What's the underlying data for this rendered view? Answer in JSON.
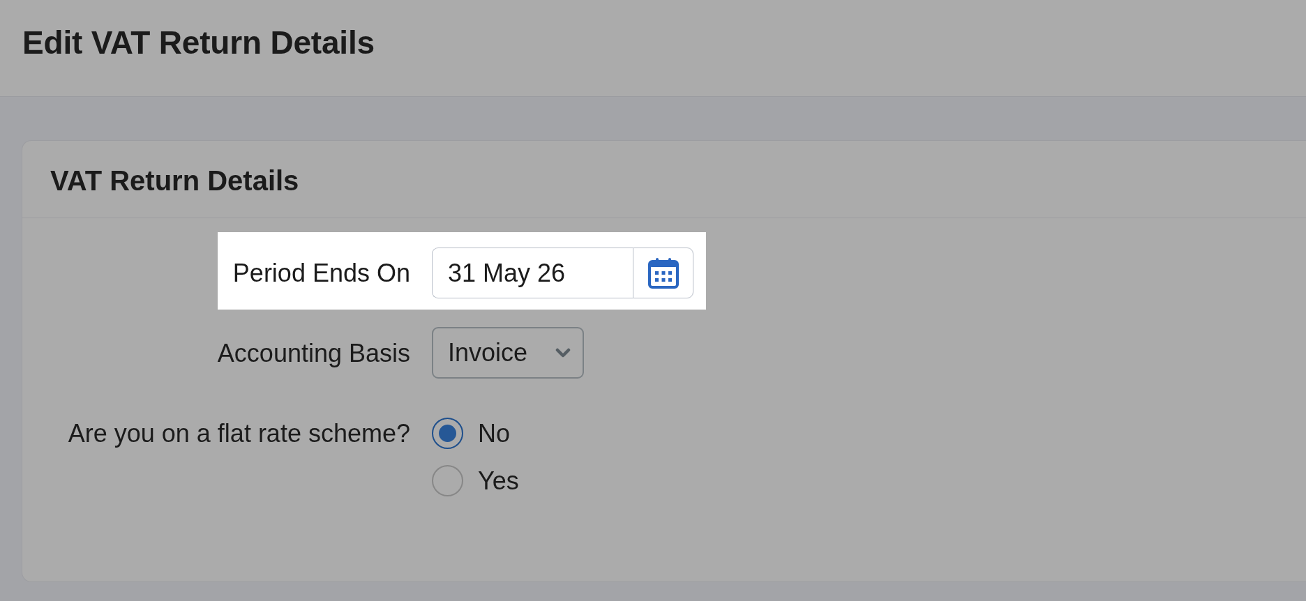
{
  "page": {
    "title": "Edit VAT Return Details"
  },
  "card": {
    "title": "VAT Return Details",
    "fields": [
      {
        "kind": "date",
        "label": "Period Ends On",
        "value": "31 May 26",
        "highlighted": true
      },
      {
        "kind": "select",
        "label": "Accounting Basis",
        "value": "Invoice",
        "highlighted": false
      },
      {
        "kind": "radio",
        "label": "Are you on a flat rate scheme?",
        "highlighted": false,
        "options": [
          {
            "label": "No",
            "selected": true
          },
          {
            "label": "Yes",
            "selected": false
          }
        ]
      }
    ]
  }
}
